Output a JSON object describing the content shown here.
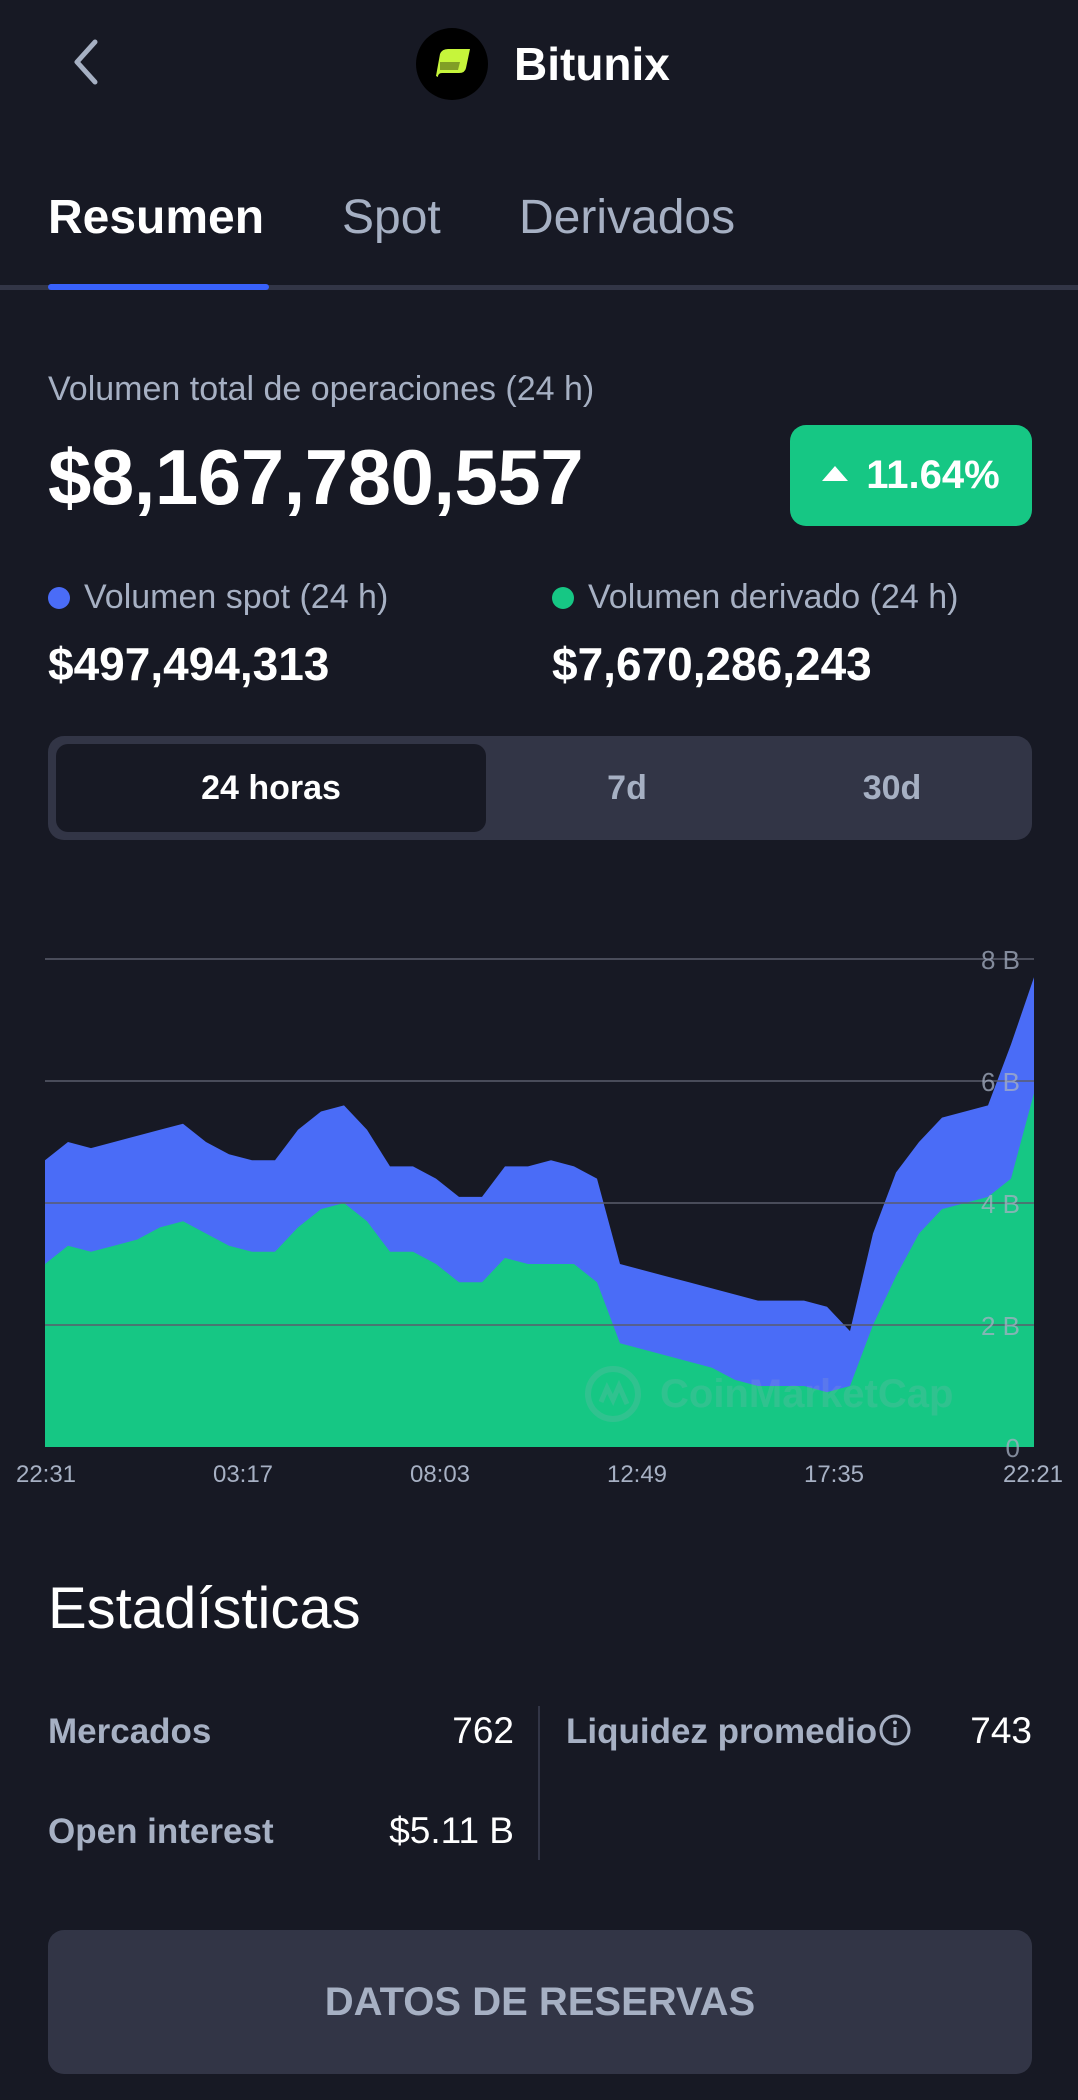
{
  "header": {
    "title": "Bitunix",
    "back_icon": "chevron-left-icon",
    "logo_icon": "bitunix-logo-icon",
    "logo_color": "#c6f53b"
  },
  "tabs": [
    {
      "label": "Resumen",
      "active": true
    },
    {
      "label": "Spot",
      "active": false
    },
    {
      "label": "Derivados",
      "active": false
    }
  ],
  "volume": {
    "label": "Volumen total de operaciones (24 h)",
    "total": "$8,167,780,557",
    "change": "11.64%",
    "change_direction": "up",
    "spot_label": "Volumen spot (24 h)",
    "spot_value": "$497,494,313",
    "derivative_label": "Volumen derivado (24 h)",
    "derivative_value": "$7,670,286,243"
  },
  "range_toggle": {
    "options": [
      "24 horas",
      "7d",
      "30d"
    ],
    "selected": "24 horas"
  },
  "colors": {
    "background": "#171924",
    "spot": "#4a6cf7",
    "derivative": "#16c784",
    "positive": "#16c784",
    "accent": "#3861fb",
    "muted": "#a6b0c3"
  },
  "chart_data": {
    "type": "area",
    "stacked": true,
    "watermark": "CoinMarketCap",
    "x_tick_labels": [
      "22:31",
      "03:17",
      "08:03",
      "12:49",
      "17:35",
      "22:21"
    ],
    "y_tick_labels": [
      "8 B",
      "6 B",
      "4 B",
      "2 B",
      "0"
    ],
    "ylim": [
      0,
      8
    ],
    "y_unit": "B",
    "grid": true,
    "series": [
      {
        "name": "Volumen derivado (24 h)",
        "color": "#16c784",
        "values": [
          3.0,
          3.3,
          3.2,
          3.3,
          3.4,
          3.6,
          3.7,
          3.5,
          3.3,
          3.2,
          3.2,
          3.6,
          3.9,
          4.0,
          3.7,
          3.2,
          3.2,
          3.0,
          2.7,
          2.7,
          3.1,
          3.0,
          3.0,
          3.0,
          2.7,
          1.7,
          1.6,
          1.5,
          1.4,
          1.3,
          1.1,
          1.0,
          1.0,
          1.0,
          0.9,
          1.0,
          2.0,
          2.8,
          3.5,
          3.9,
          4.0,
          4.1,
          4.4,
          5.8
        ]
      },
      {
        "name": "Volumen spot (24 h)",
        "color": "#4a6cf7",
        "values": [
          1.7,
          1.7,
          1.7,
          1.7,
          1.7,
          1.6,
          1.6,
          1.5,
          1.5,
          1.5,
          1.5,
          1.6,
          1.6,
          1.6,
          1.5,
          1.4,
          1.4,
          1.4,
          1.4,
          1.4,
          1.5,
          1.6,
          1.7,
          1.6,
          1.7,
          1.3,
          1.3,
          1.3,
          1.3,
          1.3,
          1.4,
          1.4,
          1.4,
          1.4,
          1.4,
          0.9,
          1.5,
          1.7,
          1.5,
          1.5,
          1.5,
          1.5,
          2.2,
          1.9
        ]
      }
    ]
  },
  "stats": {
    "title": "Estadísticas",
    "markets_label": "Mercados",
    "markets_value": "762",
    "liquidity_label": "Liquidez promedio",
    "liquidity_value": "743",
    "liquidity_info_icon": "info-icon",
    "open_interest_label": "Open interest",
    "open_interest_value": "$5.11 B"
  },
  "reserve_button": {
    "label": "DATOS DE RESERVAS"
  }
}
